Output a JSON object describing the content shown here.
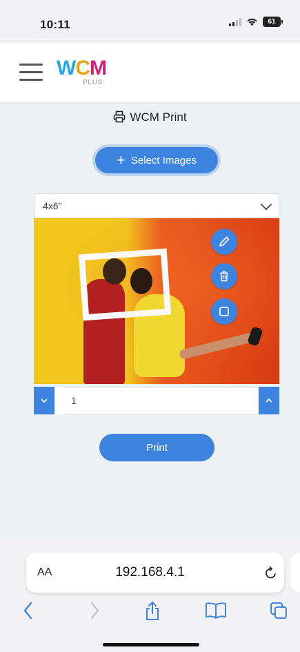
{
  "status": {
    "time": "10:11",
    "battery": "61"
  },
  "appbar": {
    "logo_letters": [
      "W",
      "C",
      "M"
    ],
    "logo_sub": "PLUS",
    "menu_icon": "hamburger-icon"
  },
  "page": {
    "title": "WCM Print",
    "title_icon": "printer-icon",
    "select_button": {
      "label": "Select Images",
      "icon": "plus-icon"
    },
    "size_select": {
      "value": "4x6\"",
      "icon": "chevron-down-icon"
    },
    "photo_tools": [
      "edit-icon",
      "trash-icon",
      "crop-icon"
    ],
    "quantity": {
      "value": "1"
    },
    "print_button": "Print"
  },
  "browser": {
    "aa": "AA",
    "url": "192.168.4.1",
    "toolbar_icons": [
      "back-icon",
      "forward-icon",
      "share-icon",
      "bookmarks-icon",
      "tabs-icon"
    ]
  },
  "colors": {
    "accent": "#3d84e0",
    "logo_blue": "#23a9e1",
    "logo_yellow": "#e6a51a",
    "logo_pink": "#d4207a"
  }
}
